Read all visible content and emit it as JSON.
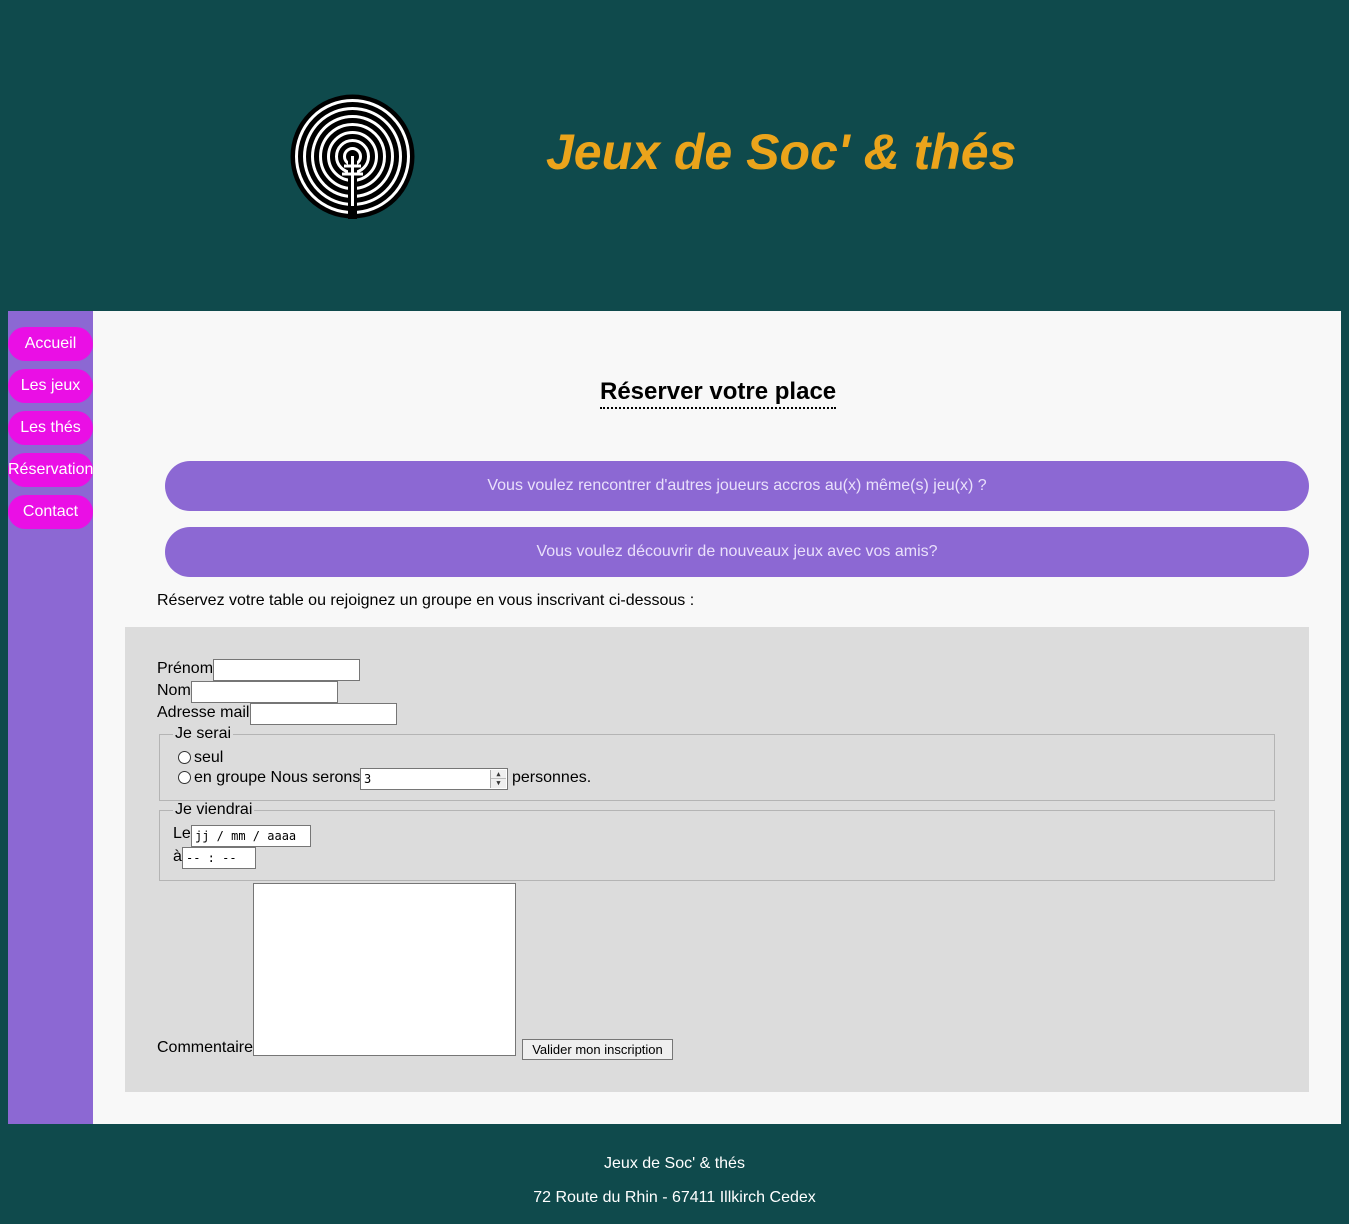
{
  "header": {
    "title": "Jeux de Soc' & thés"
  },
  "nav": {
    "items": [
      "Accueil",
      "Les jeux",
      "Les thés",
      "Réservation",
      "Contact"
    ]
  },
  "main": {
    "page_title": "Réserver votre place",
    "pills": [
      "Vous voulez rencontrer d'autres joueurs accros au(x) même(s) jeu(x) ?",
      "Vous voulez découvrir de nouveaux jeux avec vos amis?"
    ],
    "intro": "Réservez votre table ou rejoignez un groupe en vous inscrivant ci-dessous :"
  },
  "form": {
    "prenom_label": "Prénom",
    "nom_label": "Nom",
    "email_label": "Adresse mail",
    "je_serai": {
      "legend": "Je serai",
      "seul_label": "seul",
      "groupe_label": "en groupe Nous serons",
      "count_value": "3",
      "personnes_label": "personnes."
    },
    "je_viendrai": {
      "legend": "Je viendrai",
      "date_label": "Le",
      "date_placeholder": "jj / mm / aaaa",
      "time_label": "à",
      "time_placeholder": "-- : --"
    },
    "comment_label": "Commentaire",
    "submit_label": "Valider mon inscription"
  },
  "footer": {
    "name": "Jeux de Soc' & thés",
    "address": "72 Route du Rhin - 67411 Illkirch Cedex"
  },
  "colors": {
    "background": "#0f4a4c",
    "title": "#eba41b",
    "sidebar": "#8c68d3",
    "nav_button": "#ea0fe5",
    "form_box": "#dcdcdc"
  }
}
